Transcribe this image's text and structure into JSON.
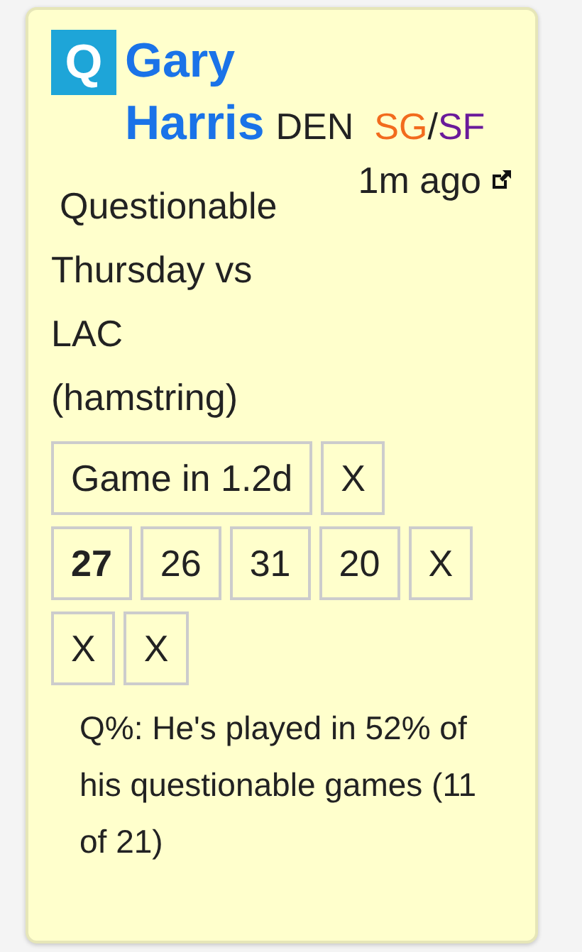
{
  "player": {
    "status": "Q",
    "name": "Gary Harris",
    "team": "DEN",
    "positions": [
      {
        "label": "SG",
        "color": "#f26b1d"
      },
      {
        "label": "SF",
        "color": "#6a1a9a"
      }
    ],
    "separator": "/"
  },
  "time": "1m ago",
  "note": "Questionable Thursday vs LAC (hamstring)",
  "schedule": [
    "Game in 1.2d",
    "X"
  ],
  "recent_games": [
    {
      "label": "27",
      "highlighted": true
    },
    {
      "label": "26",
      "highlighted": false
    },
    {
      "label": "31",
      "highlighted": false
    },
    {
      "label": "20",
      "highlighted": false
    },
    {
      "label": "X",
      "highlighted": false
    },
    {
      "label": "X",
      "highlighted": false
    },
    {
      "label": "X",
      "highlighted": false
    }
  ],
  "q_percent": "Q%: He's played in 52% of his questionable games (11 of 21)"
}
